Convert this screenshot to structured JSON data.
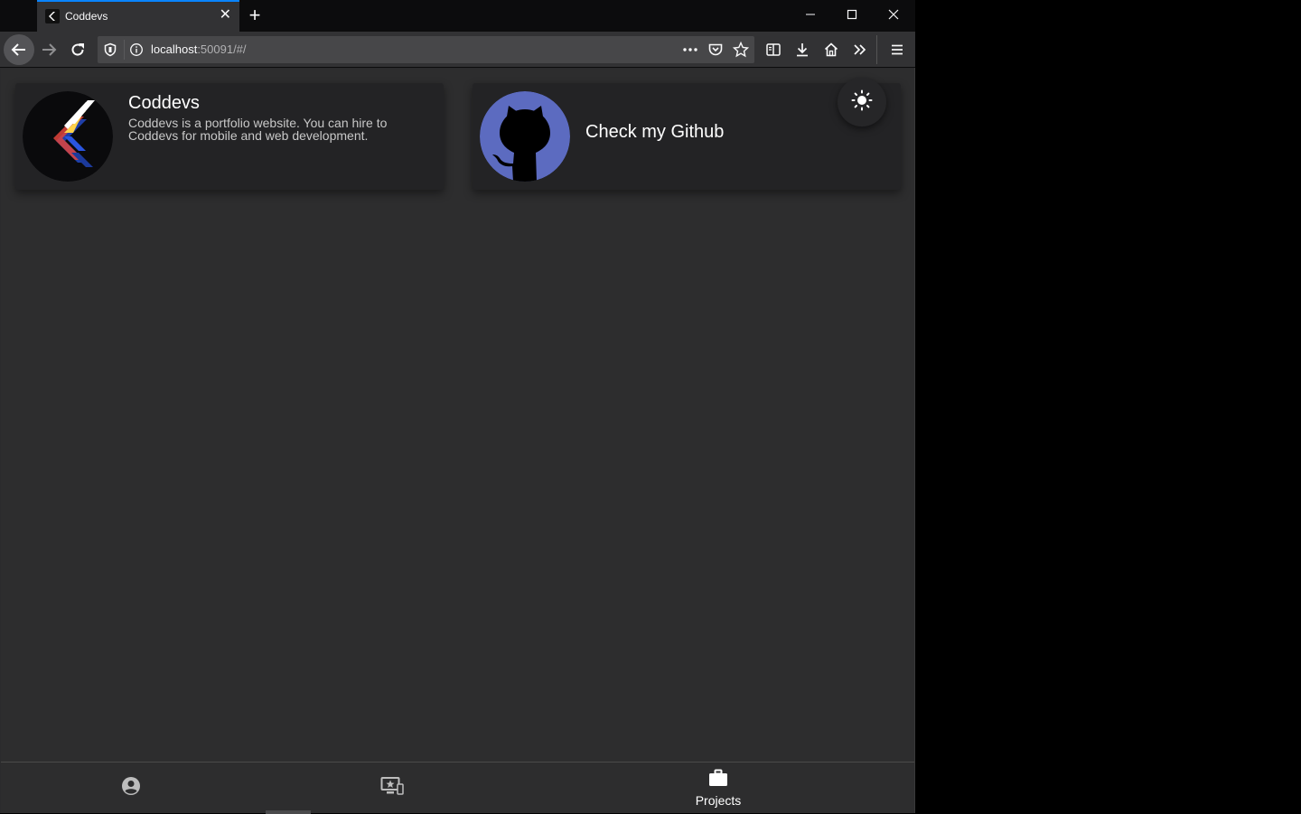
{
  "browser": {
    "tab_title": "Coddevs",
    "tab_close": "✕",
    "new_tab": "+",
    "url_host": "localhost",
    "url_rest": ":50091/#/",
    "controls": {
      "minimize": "—",
      "maximize": "☐",
      "close": "✕"
    }
  },
  "cards": {
    "portfolio": {
      "title": "Coddevs",
      "description": "Coddevs is a portfolio website. You can hire to Coddevs for mobile and web development."
    },
    "github": {
      "label": "Check my Github",
      "accent": "#5c6bc0"
    }
  },
  "bottom_nav": {
    "items": [
      {
        "icon": "account-circle-icon",
        "label": ""
      },
      {
        "icon": "desktop-star-icon",
        "label": ""
      },
      {
        "icon": "briefcase-icon",
        "label": "Projects"
      }
    ]
  },
  "colors": {
    "page_bg": "#2d2d2e",
    "card_bg": "#232325",
    "tab_accent": "#0a84ff"
  }
}
